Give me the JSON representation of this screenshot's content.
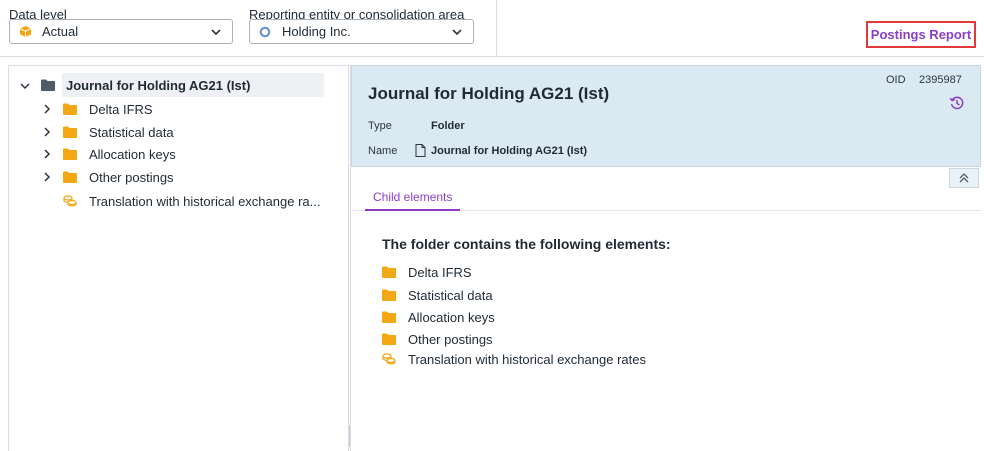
{
  "filters": {
    "data_level": {
      "label": "Data level",
      "value": "Actual",
      "icon": "cube-icon"
    },
    "entity": {
      "label": "Reporting entity or consolidation area",
      "value": "Holding Inc.",
      "icon": "circle-icon"
    }
  },
  "toolbar": {
    "report_label": "Postings Report"
  },
  "tree": {
    "root": "Journal for Holding AG21 (Ist)",
    "items": [
      {
        "label": "Delta IFRS",
        "icon": "folder-icon",
        "expandable": true
      },
      {
        "label": "Statistical data",
        "icon": "folder-icon",
        "expandable": true
      },
      {
        "label": "Allocation keys",
        "icon": "folder-icon",
        "expandable": true
      },
      {
        "label": "Other postings",
        "icon": "folder-icon",
        "expandable": true
      },
      {
        "label": "Translation with historical exchange ra...",
        "icon": "coins-icon",
        "expandable": false
      }
    ]
  },
  "detail": {
    "title": "Journal for Holding AG21 (Ist)",
    "oid_label": "OID",
    "oid_value": "2395987",
    "type_label": "Type",
    "type_value": "Folder",
    "name_label": "Name",
    "name_value": "Journal for Holding AG21 (Ist)",
    "tab": "Child elements",
    "contents_heading": "The folder contains the following elements:",
    "contents": [
      {
        "label": "Delta IFRS",
        "icon": "folder-icon"
      },
      {
        "label": "Statistical data",
        "icon": "folder-icon"
      },
      {
        "label": "Allocation keys",
        "icon": "folder-icon"
      },
      {
        "label": "Other postings",
        "icon": "folder-icon"
      },
      {
        "label": "Translation with historical exchange rates",
        "icon": "coins-icon"
      }
    ]
  },
  "colors": {
    "accent": "#8a3ec8",
    "folder": "#f3a712",
    "highlight": "#e03a3a",
    "header_bg": "#dbeaf2"
  }
}
